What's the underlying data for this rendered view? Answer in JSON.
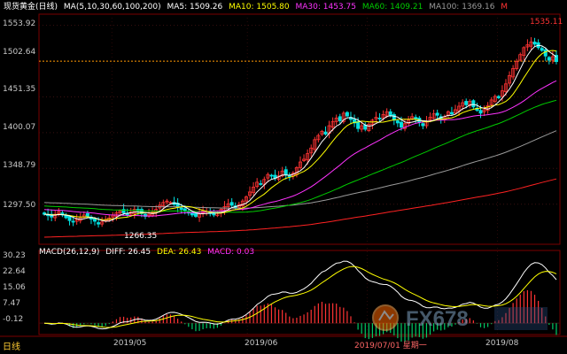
{
  "header": {
    "instrument": "现货黄金",
    "period": "(日线)",
    "ma_params": "MA(5,10,30,60,100,200)",
    "ma5": "MA5: 1509.26",
    "ma10": "MA10: 1505.80",
    "ma30": "MA30: 1453.75",
    "ma60": "MA60: 1409.21",
    "ma100": "MA100: 1369.16",
    "end_marker": "M"
  },
  "macd_header": {
    "params": "MACD(26,12,9)",
    "diff": "DIFF: 26.45",
    "dea": "DEA: 26.43",
    "macd": "MACD: 0.03"
  },
  "price_axis": [
    "1553.92",
    "1502.64",
    "1451.35",
    "1400.07",
    "1348.79",
    "1297.50"
  ],
  "macd_axis": [
    "30.23",
    "22.64",
    "15.06",
    "7.47",
    "-0.12"
  ],
  "annotations": {
    "high": "1535.11",
    "low": "1266.35"
  },
  "x_axis": [
    "2019/05",
    "2019/06",
    "2019/07/01 星期一",
    "2019/08"
  ],
  "footer": {
    "period_button": "日线"
  },
  "watermark": "FX678",
  "colors": {
    "background": "#000000",
    "up": "#ff3333",
    "down": "#00e0e0",
    "ma5": "#ffffff",
    "ma10": "#ffff00",
    "ma30": "#ff33ff",
    "ma60": "#00cc00",
    "ma100": "#9a9a9a",
    "ma200": "#ff2222",
    "diff": "#ffffff",
    "dea": "#ffff00",
    "dash": "#ff9900"
  },
  "chart_data": {
    "type": "candlestick",
    "dates": [
      "2019/05",
      "2019/06",
      "2019/07/01",
      "2019/08"
    ],
    "price_range": [
      1240,
      1570
    ],
    "current_level": 1502.64,
    "high": 1535.11,
    "low": 1266.35,
    "closes": [
      1283,
      1281,
      1279,
      1283,
      1287,
      1282,
      1278,
      1274,
      1272,
      1276,
      1279,
      1282,
      1280,
      1276,
      1273,
      1269,
      1272,
      1275,
      1278,
      1282,
      1285,
      1288,
      1285,
      1282,
      1286,
      1290,
      1288,
      1284,
      1280,
      1283,
      1286,
      1290,
      1296,
      1300,
      1302,
      1300,
      1297,
      1293,
      1290,
      1288,
      1285,
      1282,
      1280,
      1284,
      1288,
      1287,
      1284,
      1282,
      1285,
      1290,
      1294,
      1298,
      1296,
      1292,
      1297,
      1302,
      1308,
      1315,
      1322,
      1329,
      1326,
      1333,
      1340,
      1338,
      1335,
      1338,
      1345,
      1340,
      1337,
      1342,
      1350,
      1358,
      1362,
      1370,
      1378,
      1390,
      1396,
      1402,
      1398,
      1410,
      1416,
      1421,
      1417,
      1428,
      1424,
      1419,
      1414,
      1406,
      1410,
      1405,
      1412,
      1418,
      1422,
      1420,
      1426,
      1430,
      1424,
      1418,
      1414,
      1408,
      1413,
      1418,
      1423,
      1420,
      1415,
      1410,
      1416,
      1422,
      1427,
      1425,
      1419,
      1423,
      1430,
      1427,
      1433,
      1438,
      1443,
      1440,
      1445,
      1437,
      1432,
      1428,
      1433,
      1439,
      1447,
      1452,
      1450,
      1460,
      1470,
      1482,
      1492,
      1502,
      1512,
      1522,
      1526,
      1530,
      1527,
      1522,
      1518,
      1510,
      1504,
      1509,
      1502
    ],
    "series_ma": [
      "MA5",
      "MA10",
      "MA30",
      "MA60",
      "MA100",
      "MA200"
    ],
    "ma_last": {
      "MA5": 1509.26,
      "MA10": 1505.8,
      "MA30": 1453.75,
      "MA60": 1409.21,
      "MA100": 1369.16
    },
    "macd": {
      "DIFF": 26.45,
      "DEA": 26.43,
      "MACD": 0.03,
      "range": [
        -5,
        32
      ]
    }
  }
}
